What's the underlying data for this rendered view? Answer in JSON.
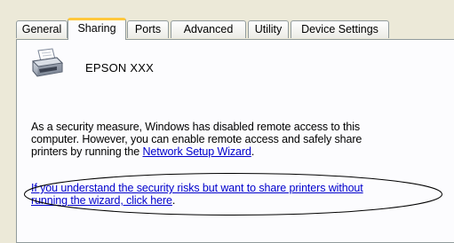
{
  "tabs": [
    {
      "label": "General",
      "active": false
    },
    {
      "label": "Sharing",
      "active": true
    },
    {
      "label": "Ports",
      "active": false
    },
    {
      "label": "Advanced",
      "active": false
    },
    {
      "label": "Utility",
      "active": false
    },
    {
      "label": "Device Settings",
      "active": false
    }
  ],
  "printer": {
    "name": "EPSON XXX",
    "icon": "printer-icon"
  },
  "message": {
    "line1": "As a security measure, Windows has disabled remote access to this",
    "line2": "computer. However, you can enable remote access and safely share",
    "line3_prefix": "printers by running the ",
    "wizard_link": "Network Setup Wizard",
    "line3_suffix": "."
  },
  "share_link": {
    "line1": "If you understand the security risks but want to share printers without",
    "line2": "running the wizard, click here",
    "line2_suffix": "."
  },
  "colors": {
    "link": "#0000cc",
    "active_tab_accent": "#ffc83c",
    "panel_border": "#919b9c"
  }
}
